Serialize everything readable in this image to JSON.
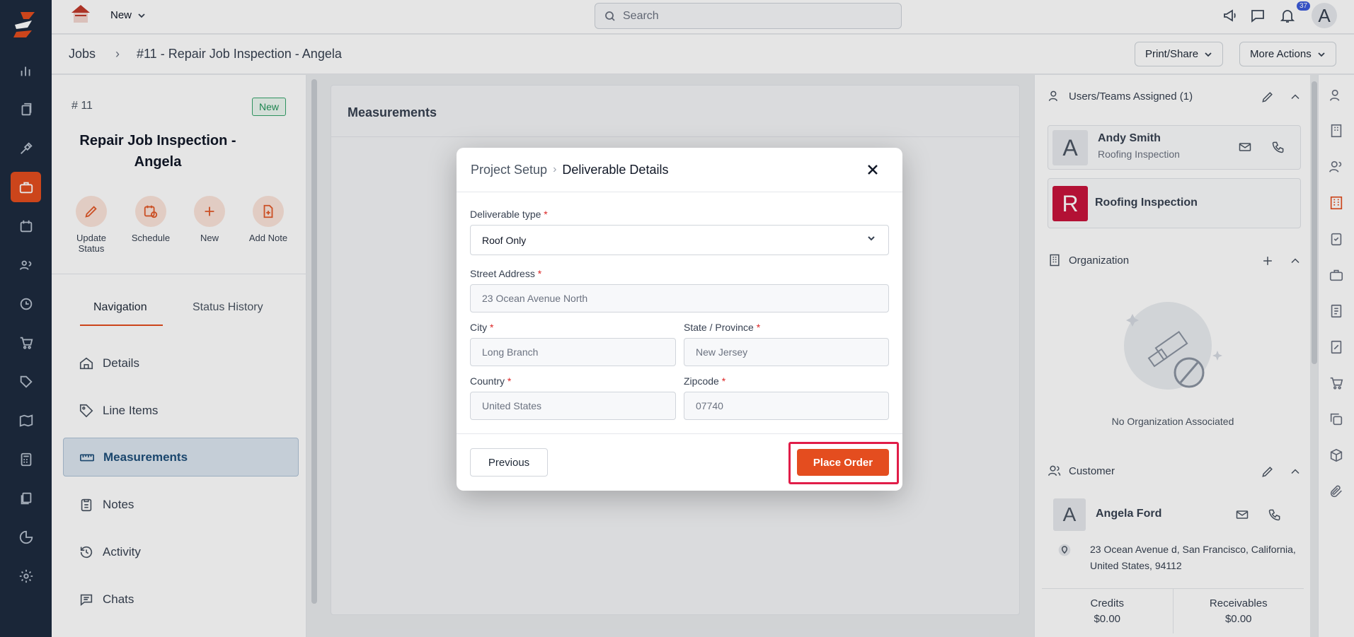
{
  "topbar": {
    "new_label": "New",
    "search_placeholder": "Search",
    "notifications_count": "37",
    "user_initial": "A"
  },
  "breadcrumb": {
    "root": "Jobs",
    "current": "#11 - Repair Job Inspection - Angela"
  },
  "header_actions": {
    "print_share": "Print/Share",
    "more_actions": "More Actions"
  },
  "job": {
    "number": "# 11",
    "status": "New",
    "title": "Repair Job Inspection - Angela"
  },
  "quick_actions": [
    {
      "label": "Update Status",
      "icon": "pencil-icon"
    },
    {
      "label": "Schedule",
      "icon": "calendar-clock-icon"
    },
    {
      "label": "New",
      "icon": "plus-icon"
    },
    {
      "label": "Add Note",
      "icon": "file-plus-icon"
    }
  ],
  "tabs": {
    "navigation": "Navigation",
    "status_history": "Status History"
  },
  "nav_items": [
    {
      "label": "Details",
      "icon": "home-icon"
    },
    {
      "label": "Line Items",
      "icon": "tag-icon"
    },
    {
      "label": "Measurements",
      "icon": "ruler-icon",
      "active": true
    },
    {
      "label": "Notes",
      "icon": "clipboard-icon"
    },
    {
      "label": "Activity",
      "icon": "history-icon"
    },
    {
      "label": "Chats",
      "icon": "chat-icon"
    }
  ],
  "center": {
    "title": "Measurements"
  },
  "right": {
    "users_header": "Users/Teams Assigned (1)",
    "user_name": "Andy Smith",
    "user_initial": "A",
    "user_team": "Roofing Inspection",
    "team_initial": "R",
    "team_name": "Roofing Inspection",
    "team_color": "#c8143c",
    "org_header": "Organization",
    "no_org": "No Organization Associated",
    "customer_header": "Customer",
    "customer_initial": "A",
    "customer_name": "Angela Ford",
    "customer_address": "23 Ocean Avenue d, San Francisco, California, United States, 94112",
    "credits_label": "Credits",
    "credits_value": "$0.00",
    "receivables_label": "Receivables",
    "receivables_value": "$0.00"
  },
  "modal": {
    "crumb_parent": "Project Setup",
    "crumb_current": "Deliverable Details",
    "deliverable_label": "Deliverable type",
    "deliverable_value": "Roof Only",
    "street_label": "Street Address",
    "street_value": "23 Ocean Avenue North",
    "city_label": "City",
    "city_value": "Long Branch",
    "state_label": "State / Province",
    "state_value": "New Jersey",
    "country_label": "Country",
    "country_value": "United States",
    "zip_label": "Zipcode",
    "zip_value": "07740",
    "previous_label": "Previous",
    "place_order_label": "Place Order",
    "required_mark": "*"
  },
  "colors": {
    "accent": "#e44d1f",
    "rail_bg": "#1d2b3f",
    "highlight": "#e11d48"
  }
}
